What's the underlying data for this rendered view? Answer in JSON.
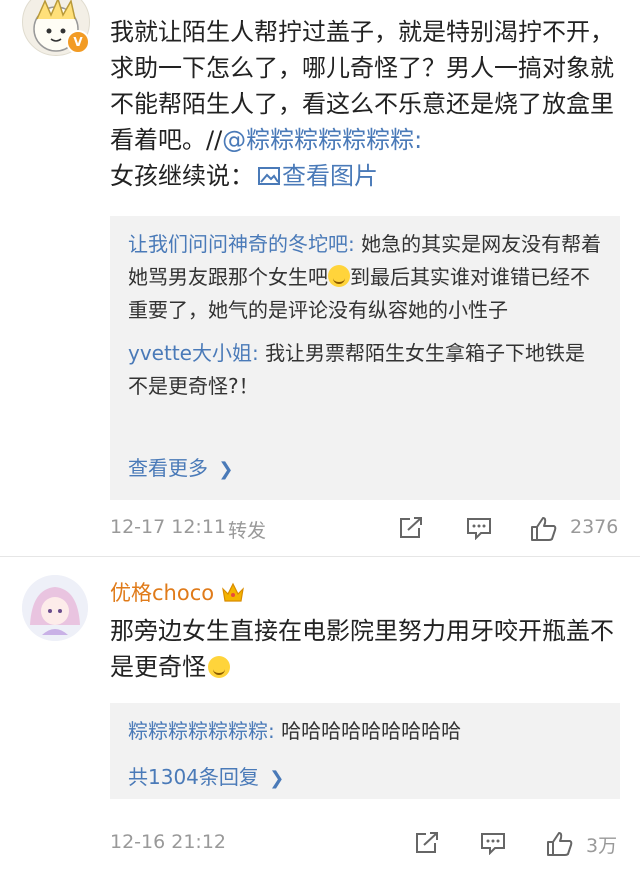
{
  "comment1": {
    "text_part1": "我就让陌生人帮拧过盖子，就是特别渴拧不开，求助一下怎么了，哪儿奇怪了？男人一搞对象就不能帮陌生人了，看这么不乐意还是烧了放盒里看着吧。//",
    "mention": "@粽粽粽粽粽粽粽:",
    "text_part2": "女孩继续说：",
    "image_link": "查看图片",
    "replies": [
      {
        "name": "让我们问问神奇的冬坨吧:",
        "text_a": "她急的其实是网友没有帮着她骂男友跟那个女生吧",
        "text_b": "到最后其实谁对谁错已经不重要了，她气的是评论没有纵容她的小性子"
      },
      {
        "name": "yvette大小姐:",
        "text": "我让男票帮陌生女生拿箱子下地铁是不是更奇怪?！"
      }
    ],
    "more_label": "查看更多",
    "time": "12-17 12:11",
    "forward_label": "转发",
    "likes": "2376"
  },
  "comment2": {
    "username": "优格choco",
    "text": "那旁边女生直接在电影院里努力用牙咬开瓶盖不是更奇怪",
    "reply": {
      "name": "粽粽粽粽粽粽粽:",
      "text": "哈哈哈哈哈哈哈哈哈"
    },
    "more_label": "共1304条回复",
    "time": "12-16 21:12",
    "likes": "3万"
  },
  "colors": {
    "link": "#4a7ab8",
    "username": "#e07b1a",
    "reply_bg": "#f2f2f2",
    "meta": "#999999"
  },
  "icons": [
    "verified-badge-icon",
    "crown-icon",
    "share-icon",
    "comment-icon",
    "thumbs-up-icon",
    "laugh-emoji-icon",
    "smirk-emoji-icon",
    "image-icon",
    "chevron-right-icon"
  ]
}
